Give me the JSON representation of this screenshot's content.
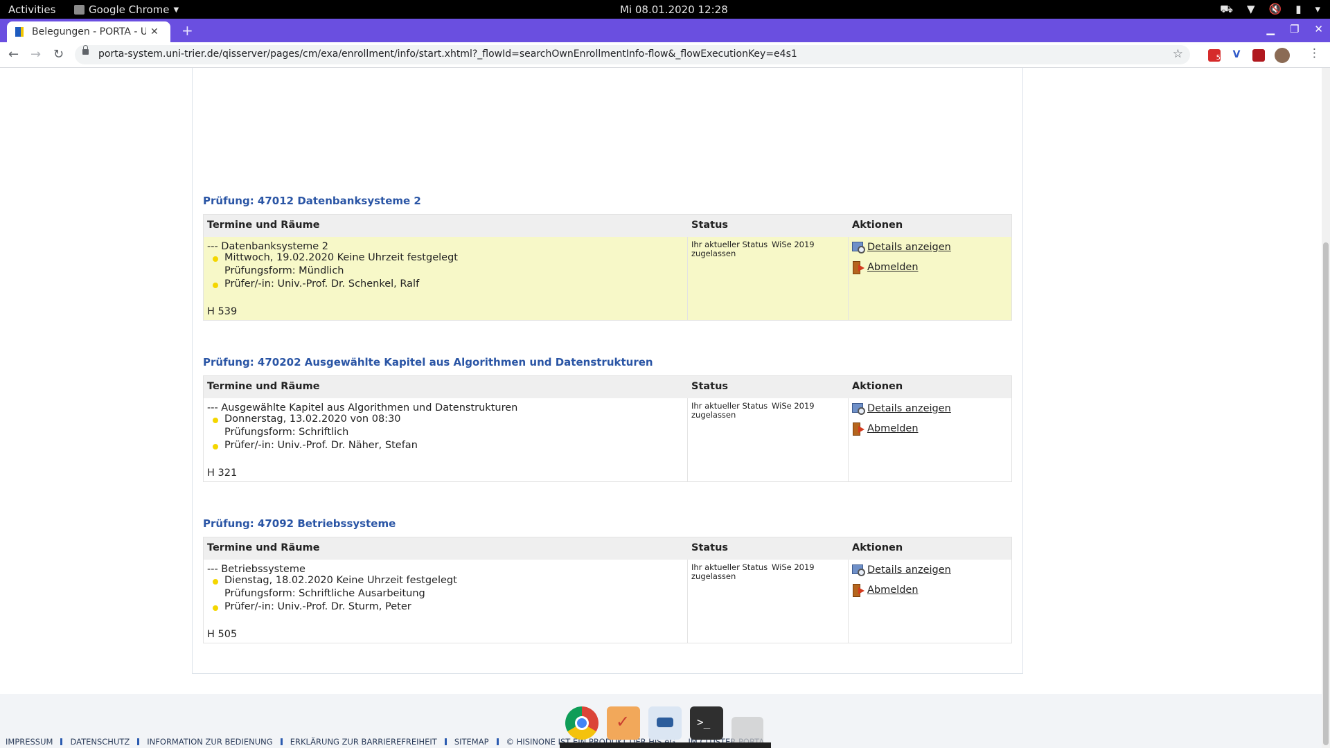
{
  "system_bar": {
    "activities": "Activities",
    "app_name": "Google Chrome",
    "clock": "Mi 08.01.2020 12:28"
  },
  "browser": {
    "tab_title": "Belegungen - PORTA - Uni",
    "new_tab": "+",
    "url": "porta-system.uni-trier.de/qisserver/pages/cm/exa/enrollment/info/start.xhtml?_flowId=searchOwnEnrollmentInfo-flow&_flowExecutionKey=e4s1",
    "extension_badge": "5"
  },
  "table_headers": {
    "dates": "Termine und Räume",
    "status": "Status",
    "actions": "Aktionen"
  },
  "exams": [
    {
      "title": "Prüfung: 47012 Datenbanksysteme 2",
      "course": "--- Datenbanksysteme 2",
      "date": "Mittwoch, 19.02.2020 Keine Uhrzeit festgelegt",
      "form": "Prüfungsform: Mündlich",
      "examiner": "Prüfer/-in: Univ.-Prof. Dr. Schenkel, Ralf",
      "room": "H 539",
      "status_label": "Ihr aktueller Status",
      "status_value": "zugelassen",
      "semester": "WiSe 2019",
      "details": "Details anzeigen",
      "deregister": "Abmelden"
    },
    {
      "title": "Prüfung: 470202 Ausgewählte Kapitel aus Algorithmen und Datenstrukturen",
      "course": "--- Ausgewählte Kapitel aus Algorithmen und Datenstrukturen",
      "date": "Donnerstag, 13.02.2020 von 08:30",
      "form": "Prüfungsform: Schriftlich",
      "examiner": "Prüfer/-in: Univ.-Prof. Dr. Näher, Stefan",
      "room": "H 321",
      "status_label": "Ihr aktueller Status",
      "status_value": "zugelassen",
      "semester": "WiSe 2019",
      "details": "Details anzeigen",
      "deregister": "Abmelden"
    },
    {
      "title": "Prüfung: 47092 Betriebssysteme",
      "course": "--- Betriebssysteme",
      "date": "Dienstag, 18.02.2020 Keine Uhrzeit festgelegt",
      "form": "Prüfungsform: Schriftliche Ausarbeitung",
      "examiner": "Prüfer/-in: Univ.-Prof. Dr. Sturm, Peter",
      "room": "H 505",
      "status_label": "Ihr aktueller Status",
      "status_value": "zugelassen",
      "semester": "WiSe 2019",
      "details": "Details anzeigen",
      "deregister": "Abmelden"
    }
  ],
  "footer": {
    "links": [
      "IMPRESSUM",
      "DATENSCHUTZ",
      "INFORMATION ZUR BEDIENUNG",
      "ERKLÄRUNG ZUR BARRIEREFREIHEIT",
      "SITEMAP"
    ],
    "credit": "© HISINONE IST EIN PRODUKT DER HIS eG ... IM CLUSTER PORTA."
  },
  "dock": {
    "apps": [
      "Google Chrome",
      "Todo",
      "Remmina",
      "Terminal",
      "Show Applications"
    ]
  }
}
